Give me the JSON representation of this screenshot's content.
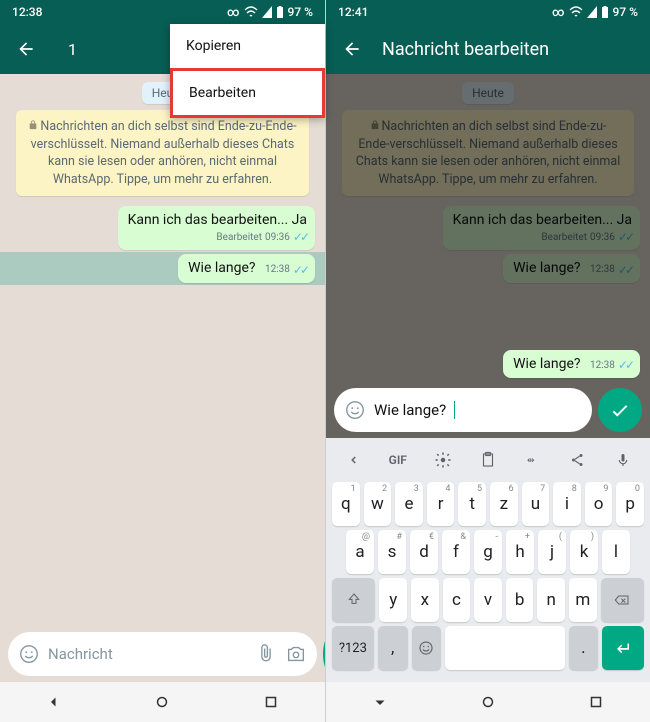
{
  "left": {
    "status": {
      "time": "12:38",
      "battery": "97 %"
    },
    "app_bar": {
      "count": "1"
    },
    "popup": {
      "copy": "Kopieren",
      "edit": "Bearbeiten"
    },
    "date_label": "Heu",
    "info_text": "Nachrichten an dich selbst sind Ende-zu-Ende-verschlüsselt. Niemand außerhalb dieses Chats kann sie lesen oder anhören, nicht einmal WhatsApp. Tippe, um mehr zu erfahren.",
    "messages": [
      {
        "text": "Kann ich das bearbeiten... Ja",
        "edited": "Bearbeitet",
        "time": "09:36"
      },
      {
        "text": "Wie lange?",
        "time": "12:38"
      }
    ],
    "input": {
      "placeholder": "Nachricht"
    }
  },
  "right": {
    "status": {
      "time": "12:41",
      "battery": "97 %"
    },
    "app_bar": {
      "title": "Nachricht bearbeiten"
    },
    "date_label": "Heute",
    "info_text": "Nachrichten an dich selbst sind Ende-zu-Ende-verschlüsselt. Niemand außerhalb dieses Chats kann sie lesen oder anhören, nicht einmal WhatsApp. Tippe, um mehr zu erfahren.",
    "messages": [
      {
        "text": "Kann ich das bearbeiten... Ja",
        "edited": "Bearbeitet",
        "time": "09:36"
      },
      {
        "text": "Wie lange?",
        "time": "12:38"
      }
    ],
    "edit": {
      "bubble_text": "Wie lange?",
      "bubble_time": "12:38",
      "input_value": "Wie lange?"
    },
    "keyboard": {
      "suggestion": "GIF",
      "row1": [
        {
          "k": "q",
          "h": "1"
        },
        {
          "k": "w",
          "h": "2"
        },
        {
          "k": "e",
          "h": "3"
        },
        {
          "k": "r",
          "h": "4"
        },
        {
          "k": "t",
          "h": "5"
        },
        {
          "k": "z",
          "h": "6"
        },
        {
          "k": "u",
          "h": "7"
        },
        {
          "k": "i",
          "h": "8"
        },
        {
          "k": "o",
          "h": "9"
        },
        {
          "k": "p",
          "h": "0"
        }
      ],
      "row2": [
        {
          "k": "a",
          "h": "@"
        },
        {
          "k": "s",
          "h": "#"
        },
        {
          "k": "d",
          "h": "€"
        },
        {
          "k": "f",
          "h": "&"
        },
        {
          "k": "g",
          "h": "-"
        },
        {
          "k": "h",
          "h": "+"
        },
        {
          "k": "j",
          "h": "("
        },
        {
          "k": "k",
          "h": ")"
        },
        {
          "k": "l",
          "h": ""
        }
      ],
      "row3": [
        {
          "k": "y",
          "h": ""
        },
        {
          "k": "x",
          "h": ""
        },
        {
          "k": "c",
          "h": ""
        },
        {
          "k": "v",
          "h": ""
        },
        {
          "k": "b",
          "h": ""
        },
        {
          "k": "n",
          "h": ""
        },
        {
          "k": "m",
          "h": ""
        }
      ],
      "sym_key": "?123",
      "comma_key": ",",
      "period_key": "."
    }
  }
}
